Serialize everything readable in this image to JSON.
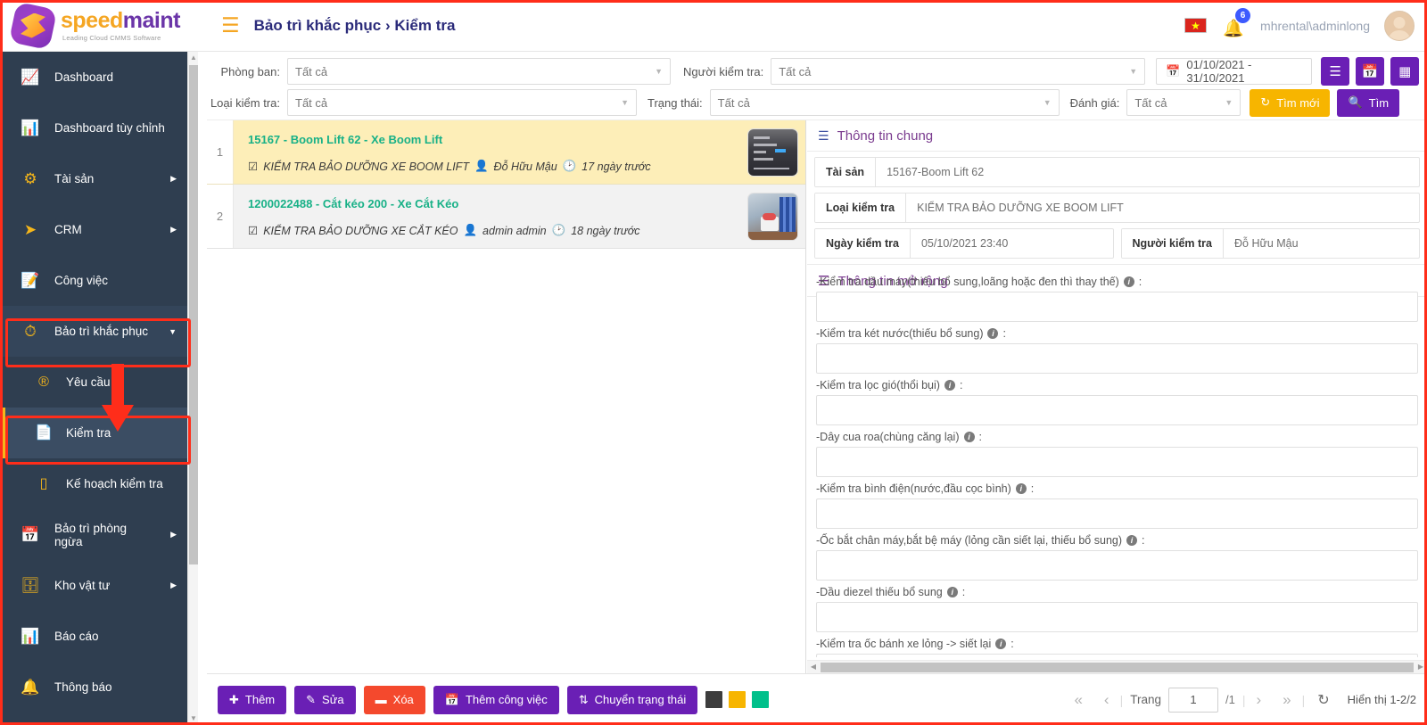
{
  "app": {
    "brand_primary": "speed",
    "brand_secondary": "maint",
    "brand_tagline": "Leading Cloud CMMS Software",
    "accent_purple": "#6a1fb5",
    "accent_yellow": "#f5b61a",
    "accent_green": "#18b187",
    "accent_red": "#f4492d"
  },
  "header": {
    "menu_icon": "hamburger-icon",
    "breadcrumb_parent": "Bảo trì khắc phục",
    "breadcrumb_separator": "›",
    "breadcrumb_current": "Kiểm tra",
    "language_flag": "vietnam-flag-icon",
    "notification_icon": "bell-icon",
    "notification_count": "6",
    "username": "mhrental\\adminlong",
    "avatar": "user-avatar"
  },
  "sidebar": {
    "items": [
      {
        "label": "Dashboard",
        "icon": "dashboard-icon",
        "expandable": false
      },
      {
        "label": "Dashboard tùy chỉnh",
        "icon": "custom-dashboard-icon",
        "expandable": false
      },
      {
        "label": "Tài sản",
        "icon": "assets-icon",
        "expandable": true
      },
      {
        "label": "CRM",
        "icon": "crm-icon",
        "expandable": true
      },
      {
        "label": "Công việc",
        "icon": "tasks-icon",
        "expandable": false
      },
      {
        "label": "Bảo trì khắc phục",
        "icon": "corrective-maintenance-icon",
        "expandable": true,
        "open": true
      },
      {
        "label": "Bảo trì phòng ngừa",
        "icon": "preventive-maintenance-icon",
        "expandable": true
      },
      {
        "label": "Kho vật tư",
        "icon": "warehouse-icon",
        "expandable": true
      },
      {
        "label": "Báo cáo",
        "icon": "report-icon",
        "expandable": false
      },
      {
        "label": "Thông báo",
        "icon": "notification-icon",
        "expandable": false
      }
    ],
    "submenu": [
      {
        "label": "Yêu cầu",
        "icon": "request-icon",
        "active": false
      },
      {
        "label": "Kiểm tra",
        "icon": "inspection-icon",
        "active": true
      },
      {
        "label": "Kế hoạch kiểm tra",
        "icon": "inspection-plan-icon",
        "active": false
      }
    ]
  },
  "filters": {
    "department": {
      "label": "Phòng ban:",
      "value": "Tất cả"
    },
    "inspector": {
      "label": "Người kiểm tra:",
      "value": "Tất cả"
    },
    "inspection_type": {
      "label": "Loại kiểm tra:",
      "value": "Tất cả"
    },
    "status": {
      "label": "Trạng thái:",
      "value": "Tất cả"
    },
    "rating": {
      "label": "Đánh giá:",
      "value": "Tất cả"
    },
    "date_range": {
      "value": "01/10/2021 - 31/10/2021",
      "icon": "calendar-icon"
    },
    "view_buttons": [
      {
        "icon": "list-view-icon"
      },
      {
        "icon": "calendar-view-icon"
      },
      {
        "icon": "board-view-icon"
      }
    ],
    "refresh_button": {
      "label": "Tìm mới",
      "icon": "refresh-icon"
    },
    "search_button": {
      "label": "Tìm",
      "icon": "search-icon"
    }
  },
  "list": {
    "rows": [
      {
        "index": "1",
        "title": "15167 - Boom Lift 62 - Xe Boom Lift",
        "type": "KIỂM TRA BẢO DƯỠNG XE BOOM LIFT",
        "user": "Đỗ Hữu Mậu",
        "time": "17 ngày trước",
        "selected": true
      },
      {
        "index": "2",
        "title": "1200022488 - Cắt kéo 200 - Xe Cắt Kéo",
        "type": "KIỂM TRA BẢO DƯỠNG XE CẮT KÉO",
        "user": "admin admin",
        "time": "18 ngày trước",
        "selected": false
      }
    ]
  },
  "detail": {
    "general_section": {
      "title": "Thông tin chung",
      "icon": "list-icon"
    },
    "fields": [
      {
        "key": "Tài sản",
        "value": "15167-Boom Lift 62"
      },
      {
        "key": "Loại kiểm tra",
        "value": "KIỂM TRA BẢO DƯỠNG XE BOOM LIFT"
      },
      {
        "key": "Ngày kiểm tra",
        "value": "05/10/2021 23:40"
      },
      {
        "key": "Người kiểm tra",
        "value": "Đỗ Hữu Mậu"
      }
    ],
    "extended_section": {
      "title": "Thông tin mở rộng",
      "icon": "extended-list-icon"
    },
    "extended_fields": [
      {
        "label": "-Kiểm tra dầu máy(thiếu bổ sung,loãng hoặc đen thì thay thế)",
        "value": ""
      },
      {
        "label": "-Kiểm tra két nước(thiếu bổ sung)",
        "value": ""
      },
      {
        "label": "-Kiểm tra lọc gió(thổi bụi)",
        "value": ""
      },
      {
        "label": "-Dây cua roa(chùng căng lại)",
        "value": ""
      },
      {
        "label": "-Kiểm tra bình điện(nước,đầu cọc bình)",
        "value": ""
      },
      {
        "label": "-Ốc bắt chân máy,bắt bệ máy (lỏng cần siết lại, thiếu bổ sung)",
        "value": ""
      },
      {
        "label": "-Dầu diezel thiếu bổ sung",
        "value": ""
      },
      {
        "label": "-Kiểm tra ốc bánh xe lỏng -> siết lại",
        "value": ""
      }
    ]
  },
  "footer": {
    "buttons": [
      {
        "label": "Thêm",
        "icon": "plus-icon",
        "style": "purple"
      },
      {
        "label": "Sửa",
        "icon": "pencil-icon",
        "style": "purple"
      },
      {
        "label": "Xóa",
        "icon": "minus-icon",
        "style": "red"
      },
      {
        "label": "Thêm công việc",
        "icon": "calendar-plus-icon",
        "style": "purple"
      },
      {
        "label": "Chuyển trạng thái",
        "icon": "transfer-icon",
        "style": "purple"
      }
    ],
    "legend_swatches": [
      "#3d3d3d",
      "#f7b500",
      "#00c08b"
    ],
    "pager": {
      "first_icon": "first-page-icon",
      "prev_icon": "prev-page-icon",
      "page_label": "Trang",
      "page_value": "1",
      "total_pages": "/1",
      "next_icon": "next-page-icon",
      "last_icon": "last-page-icon",
      "refresh_icon": "refresh-icon",
      "showing": "Hiển thị 1-2/2"
    }
  }
}
